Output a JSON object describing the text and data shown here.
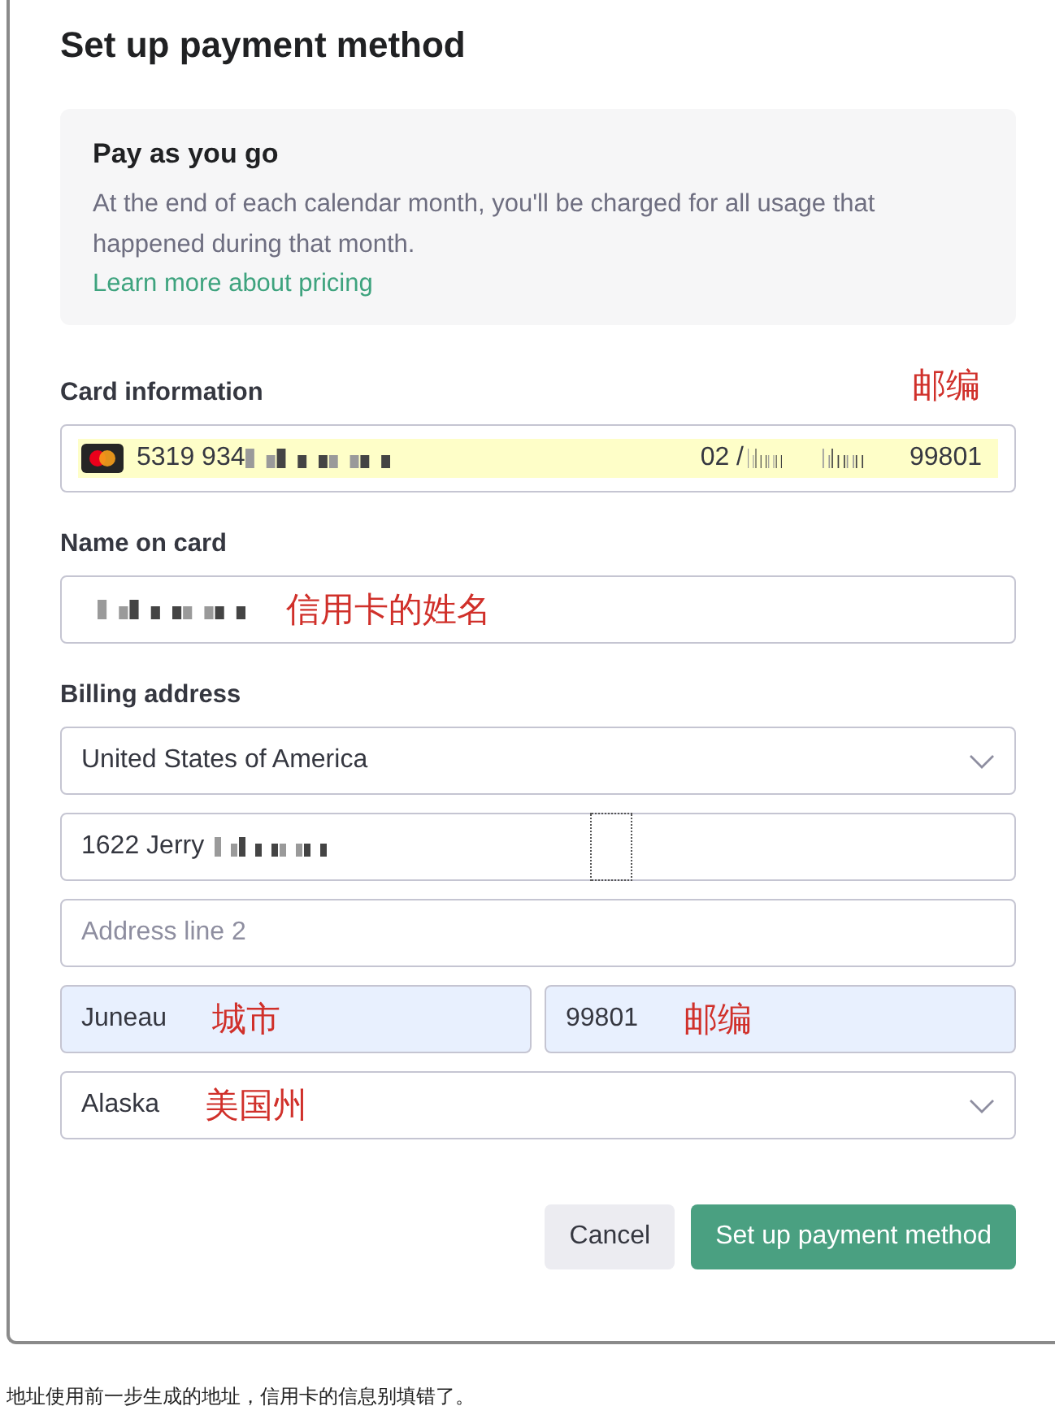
{
  "dialog": {
    "title": "Set up payment method",
    "plan": {
      "title": "Pay as you go",
      "description": "At the end of each calendar month, you'll be charged for all usage that happened during that month.",
      "link": "Learn more about pricing"
    },
    "card_information": {
      "label": "Card information",
      "annotation": "邮编",
      "card_number": "5319 934",
      "number_redacted": true,
      "expiry": "02 / ",
      "expiry_redacted": true,
      "postal_code": "99801",
      "autofilled": true
    },
    "name_on_card": {
      "label": "Name on card",
      "redacted": true,
      "annotation": "信用卡的姓名",
      "autofilled": false
    },
    "billing_address": {
      "label": "Billing address",
      "rows": [
        [
          {
            "kind": "select",
            "value": "United States of America",
            "autofilled": false
          }
        ],
        [
          {
            "kind": "input",
            "value": "1622 Jerry",
            "redacted": true,
            "focus_outline": true,
            "autofilled": false
          }
        ],
        [
          {
            "kind": "input",
            "placeholder": "Address line 2",
            "autofilled": false
          }
        ],
        [
          {
            "kind": "input",
            "value": "Juneau",
            "annotation": "城市",
            "autofilled": true
          },
          {
            "kind": "input",
            "value": "99801",
            "annotation": "邮编",
            "autofilled": true
          }
        ],
        [
          {
            "kind": "select",
            "value": "Alaska",
            "annotation": "美国州",
            "autofilled": false
          }
        ]
      ]
    },
    "buttons": [
      {
        "label": "Cancel",
        "kind": "secondary"
      },
      {
        "label": "Set up payment method",
        "kind": "primary"
      }
    ]
  },
  "caption": "地址使用前一步生成的地址，信用卡的信息别填错了。"
}
